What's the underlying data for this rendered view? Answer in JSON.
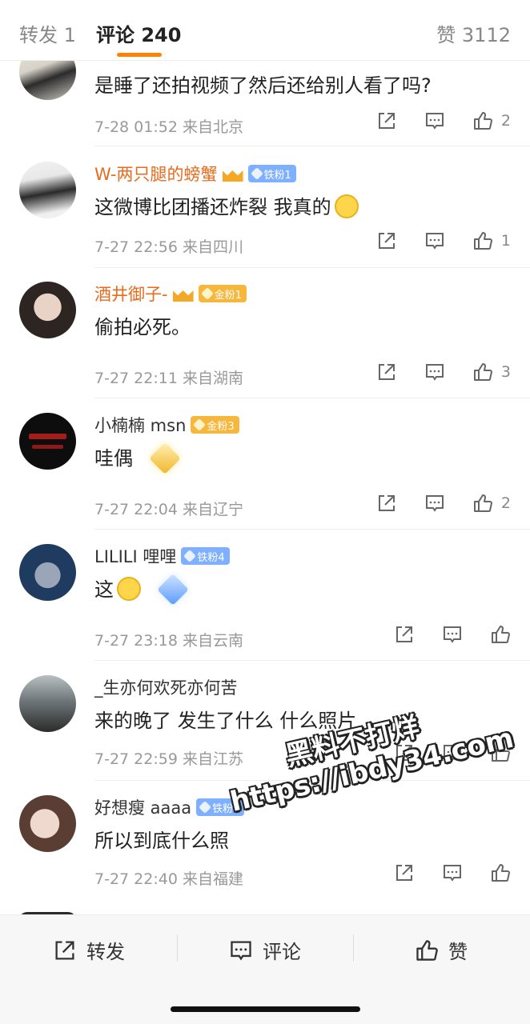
{
  "tabs": {
    "repost": "转发 1",
    "comments": "评论 240",
    "likes": "赞 3112"
  },
  "comments": [
    {
      "username": "",
      "text": "是睡了还拍视频了然后还给别人看了吗?",
      "time": "7-28 01:52",
      "location": "来自北京",
      "likes": "2"
    },
    {
      "username": "W-两只腿的螃蟹",
      "badge": "铁粉1",
      "text": "这微博比团播还炸裂 我真的",
      "time": "7-27 22:56",
      "location": "来自四川",
      "likes": "1"
    },
    {
      "username": "酒井御子-",
      "badge": "金粉1",
      "text": "偷拍必死。",
      "time": "7-27 22:11",
      "location": "来自湖南",
      "likes": "3"
    },
    {
      "username": "小楠楠 msn",
      "badge": "金粉3",
      "text": "哇偶",
      "time": "7-27 22:04",
      "location": "来自辽宁",
      "likes": "2"
    },
    {
      "username": "LILILI 哩哩",
      "badge": "铁粉4",
      "text": "这",
      "time": "7-27 23:18",
      "location": "来自云南",
      "likes": ""
    },
    {
      "username": "_生亦何欢死亦何苦",
      "text": "来的晚了  发生了什么 什么照片",
      "time": "7-27 22:59",
      "location": "来自江苏",
      "likes": ""
    },
    {
      "username": "好想瘦 aaaa",
      "badge": "铁粉2",
      "text": "所以到底什么照",
      "time": "7-27 22:40",
      "location": "来自福建",
      "likes": ""
    }
  ],
  "bottom_bar": {
    "repost": "转发",
    "comment": "评论",
    "like": "赞"
  },
  "watermark": {
    "line1": "黑料不打烊",
    "line2": "https://ibdy34.com"
  },
  "colors": {
    "accent": "#ff8200",
    "username_highlight": "#e86a1c",
    "iron_badge": "#7fb0ff",
    "gold_badge": "#f6b73c"
  }
}
